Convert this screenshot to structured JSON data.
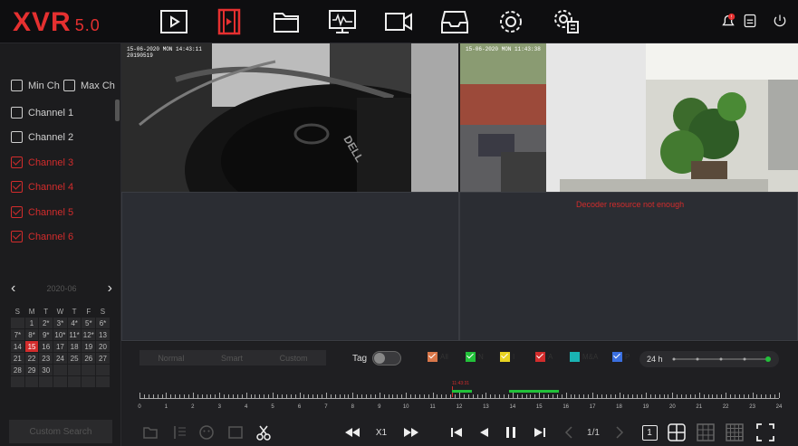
{
  "app": {
    "logo_text": "XVR",
    "logo_version": "5.0"
  },
  "toolbar": {
    "icons": [
      "playback-icon",
      "video-file-icon",
      "folder-icon",
      "monitor-icon",
      "camera-icon",
      "inbox-icon",
      "gear-icon",
      "settings-doc-icon"
    ],
    "active_index": 1,
    "alarm_badge": "!"
  },
  "sidebar": {
    "min_ch": "Min Ch",
    "max_ch": "Max Ch",
    "channels": [
      {
        "label": "Channel 1",
        "checked": false
      },
      {
        "label": "Channel 2",
        "checked": false
      },
      {
        "label": "Channel 3",
        "checked": true
      },
      {
        "label": "Channel 4",
        "checked": true
      },
      {
        "label": "Channel 5",
        "checked": true
      },
      {
        "label": "Channel 6",
        "checked": true
      }
    ],
    "calendar": {
      "month": "2020-06",
      "weekdays": [
        "S",
        "M",
        "T",
        "W",
        "T",
        "F",
        "S"
      ],
      "weeks": [
        [
          "",
          "1",
          "2*",
          "3*",
          "4*",
          "5*",
          "6*"
        ],
        [
          "7*",
          "8*",
          "9*",
          "10*",
          "11*",
          "12*",
          "13"
        ],
        [
          "14",
          "15",
          "16",
          "17",
          "18",
          "19",
          "20"
        ],
        [
          "21",
          "22",
          "23",
          "24",
          "25",
          "26",
          "27"
        ],
        [
          "28",
          "29",
          "30",
          "",
          "",
          "",
          ""
        ],
        [
          "",
          "",
          "",
          "",
          "",
          "",
          ""
        ]
      ],
      "today": "15"
    },
    "custom_search": "Custom Search"
  },
  "video": {
    "cam1_osd": "15-06-2020 MON 14:43:11",
    "cam1_osd2": "20190519",
    "cam2_osd": "15-06-2020 MON 11:43:38",
    "error": "Decoder resource not enough"
  },
  "controls": {
    "modes": [
      "Normal",
      "Smart",
      "Custom"
    ],
    "tag_label": "Tag",
    "legend": [
      {
        "label": "All",
        "color": "#d9774a"
      },
      {
        "label": "N",
        "color": "#22c13a"
      },
      {
        "label": "I",
        "color": "#e8d422"
      },
      {
        "label": "A",
        "color": "#d22c2c"
      },
      {
        "label": "M&A",
        "color": "#1ab3b3"
      },
      {
        "label": "P",
        "color": "#3a6fe0"
      }
    ],
    "zoom_label": "24 h",
    "timeline_labels": [
      "0",
      "1",
      "2",
      "3",
      "4",
      "5",
      "6",
      "7",
      "8",
      "9",
      "10",
      "11",
      "12",
      "13",
      "14",
      "15",
      "16",
      "17",
      "18",
      "19",
      "20",
      "21",
      "22",
      "23",
      "24"
    ],
    "cursor_time": "11:43:31",
    "speed": "X1",
    "page": "1/1",
    "layout_one": "1"
  }
}
